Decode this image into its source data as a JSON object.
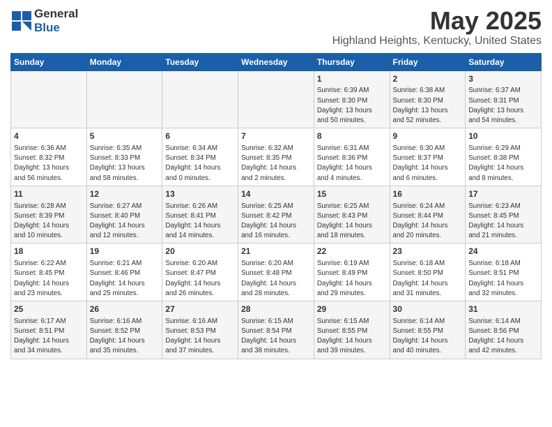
{
  "header": {
    "logo_general": "General",
    "logo_blue": "Blue",
    "title": "May 2025",
    "subtitle": "Highland Heights, Kentucky, United States"
  },
  "days_of_week": [
    "Sunday",
    "Monday",
    "Tuesday",
    "Wednesday",
    "Thursday",
    "Friday",
    "Saturday"
  ],
  "weeks": [
    [
      {
        "day": "",
        "info": ""
      },
      {
        "day": "",
        "info": ""
      },
      {
        "day": "",
        "info": ""
      },
      {
        "day": "",
        "info": ""
      },
      {
        "day": "1",
        "info": "Sunrise: 6:39 AM\nSunset: 8:30 PM\nDaylight: 13 hours\nand 50 minutes."
      },
      {
        "day": "2",
        "info": "Sunrise: 6:38 AM\nSunset: 8:30 PM\nDaylight: 13 hours\nand 52 minutes."
      },
      {
        "day": "3",
        "info": "Sunrise: 6:37 AM\nSunset: 8:31 PM\nDaylight: 13 hours\nand 54 minutes."
      }
    ],
    [
      {
        "day": "4",
        "info": "Sunrise: 6:36 AM\nSunset: 8:32 PM\nDaylight: 13 hours\nand 56 minutes."
      },
      {
        "day": "5",
        "info": "Sunrise: 6:35 AM\nSunset: 8:33 PM\nDaylight: 13 hours\nand 58 minutes."
      },
      {
        "day": "6",
        "info": "Sunrise: 6:34 AM\nSunset: 8:34 PM\nDaylight: 14 hours\nand 0 minutes."
      },
      {
        "day": "7",
        "info": "Sunrise: 6:32 AM\nSunset: 8:35 PM\nDaylight: 14 hours\nand 2 minutes."
      },
      {
        "day": "8",
        "info": "Sunrise: 6:31 AM\nSunset: 8:36 PM\nDaylight: 14 hours\nand 4 minutes."
      },
      {
        "day": "9",
        "info": "Sunrise: 6:30 AM\nSunset: 8:37 PM\nDaylight: 14 hours\nand 6 minutes."
      },
      {
        "day": "10",
        "info": "Sunrise: 6:29 AM\nSunset: 8:38 PM\nDaylight: 14 hours\nand 8 minutes."
      }
    ],
    [
      {
        "day": "11",
        "info": "Sunrise: 6:28 AM\nSunset: 8:39 PM\nDaylight: 14 hours\nand 10 minutes."
      },
      {
        "day": "12",
        "info": "Sunrise: 6:27 AM\nSunset: 8:40 PM\nDaylight: 14 hours\nand 12 minutes."
      },
      {
        "day": "13",
        "info": "Sunrise: 6:26 AM\nSunset: 8:41 PM\nDaylight: 14 hours\nand 14 minutes."
      },
      {
        "day": "14",
        "info": "Sunrise: 6:25 AM\nSunset: 8:42 PM\nDaylight: 14 hours\nand 16 minutes."
      },
      {
        "day": "15",
        "info": "Sunrise: 6:25 AM\nSunset: 8:43 PM\nDaylight: 14 hours\nand 18 minutes."
      },
      {
        "day": "16",
        "info": "Sunrise: 6:24 AM\nSunset: 8:44 PM\nDaylight: 14 hours\nand 20 minutes."
      },
      {
        "day": "17",
        "info": "Sunrise: 6:23 AM\nSunset: 8:45 PM\nDaylight: 14 hours\nand 21 minutes."
      }
    ],
    [
      {
        "day": "18",
        "info": "Sunrise: 6:22 AM\nSunset: 8:45 PM\nDaylight: 14 hours\nand 23 minutes."
      },
      {
        "day": "19",
        "info": "Sunrise: 6:21 AM\nSunset: 8:46 PM\nDaylight: 14 hours\nand 25 minutes."
      },
      {
        "day": "20",
        "info": "Sunrise: 6:20 AM\nSunset: 8:47 PM\nDaylight: 14 hours\nand 26 minutes."
      },
      {
        "day": "21",
        "info": "Sunrise: 6:20 AM\nSunset: 8:48 PM\nDaylight: 14 hours\nand 28 minutes."
      },
      {
        "day": "22",
        "info": "Sunrise: 6:19 AM\nSunset: 8:49 PM\nDaylight: 14 hours\nand 29 minutes."
      },
      {
        "day": "23",
        "info": "Sunrise: 6:18 AM\nSunset: 8:50 PM\nDaylight: 14 hours\nand 31 minutes."
      },
      {
        "day": "24",
        "info": "Sunrise: 6:18 AM\nSunset: 8:51 PM\nDaylight: 14 hours\nand 32 minutes."
      }
    ],
    [
      {
        "day": "25",
        "info": "Sunrise: 6:17 AM\nSunset: 8:51 PM\nDaylight: 14 hours\nand 34 minutes."
      },
      {
        "day": "26",
        "info": "Sunrise: 6:16 AM\nSunset: 8:52 PM\nDaylight: 14 hours\nand 35 minutes."
      },
      {
        "day": "27",
        "info": "Sunrise: 6:16 AM\nSunset: 8:53 PM\nDaylight: 14 hours\nand 37 minutes."
      },
      {
        "day": "28",
        "info": "Sunrise: 6:15 AM\nSunset: 8:54 PM\nDaylight: 14 hours\nand 38 minutes."
      },
      {
        "day": "29",
        "info": "Sunrise: 6:15 AM\nSunset: 8:55 PM\nDaylight: 14 hours\nand 39 minutes."
      },
      {
        "day": "30",
        "info": "Sunrise: 6:14 AM\nSunset: 8:55 PM\nDaylight: 14 hours\nand 40 minutes."
      },
      {
        "day": "31",
        "info": "Sunrise: 6:14 AM\nSunset: 8:56 PM\nDaylight: 14 hours\nand 42 minutes."
      }
    ]
  ]
}
